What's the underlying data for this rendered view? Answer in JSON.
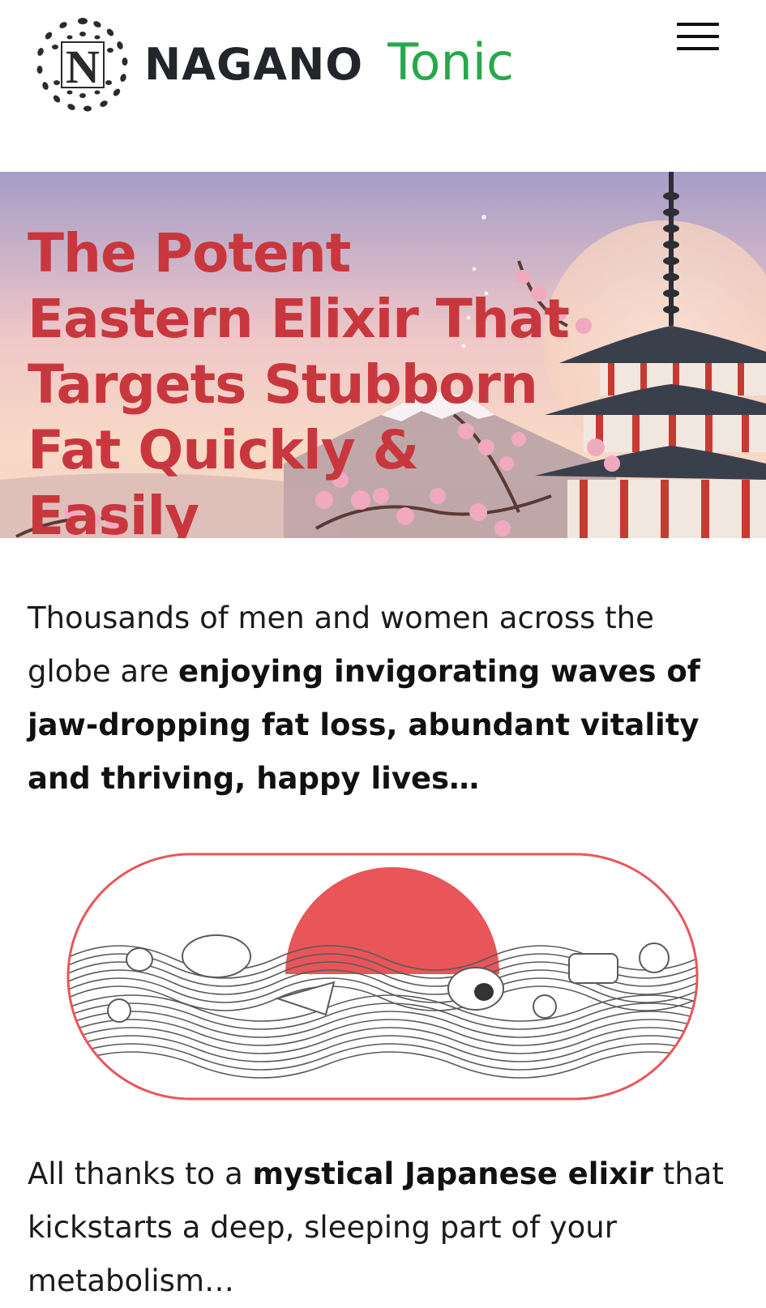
{
  "header": {
    "brand_main": "NAGANO",
    "brand_sub": "Tonic",
    "logo_letter": "N",
    "menu_icon": "hamburger-menu-icon",
    "colors": {
      "brand_dark": "#22252a",
      "brand_green": "#27a84a"
    }
  },
  "hero": {
    "title": "The Potent Eastern Elixir That Targets Stubborn Fat Quickly & Easily",
    "title_color": "#c9373e"
  },
  "body": {
    "p1_a": "Thousands of men and women across the globe are ",
    "p1_b": "enjoying invigorating waves of jaw-dropping fat loss, abundant vitality and thriving, happy lives…",
    "p2_a": "All thanks to a ",
    "p2_b": "mystical Japanese elixir",
    "p2_c": " that kickstarts a deep, sleeping part of your metabolism…"
  },
  "emblem": {
    "icon": "rising-sun-waves-illustration",
    "colors": {
      "sun": "#e8565a",
      "outline": "#e8565a",
      "lines": "#5a5a5a"
    }
  }
}
